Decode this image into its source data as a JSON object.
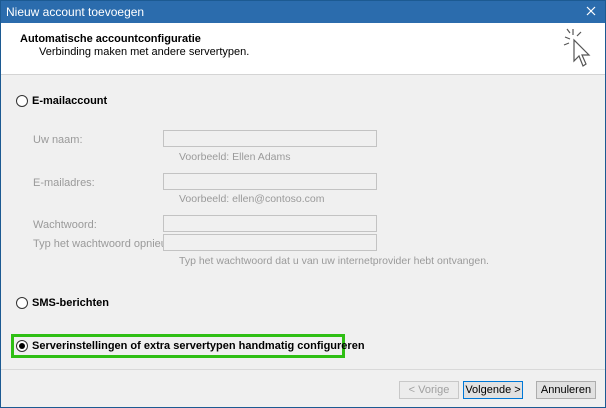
{
  "window": {
    "title": "Nieuw account toevoegen"
  },
  "header": {
    "title": "Automatische accountconfiguratie",
    "subtitle": "Verbinding maken met andere servertypen."
  },
  "options": {
    "email_account": "E-mailaccount",
    "sms": "SMS-berichten",
    "manual": "Serverinstellingen of extra servertypen handmatig configureren",
    "selected": "manual"
  },
  "fields": {
    "name_label": "Uw naam:",
    "name_hint": "Voorbeeld: Ellen Adams",
    "email_label": "E-mailadres:",
    "email_hint": "Voorbeeld: ellen@contoso.com",
    "password_label": "Wachtwoord:",
    "retype_label": "Typ het wachtwoord opnieuw:",
    "password_hint": "Typ het wachtwoord dat u van uw internetprovider hebt ontvangen."
  },
  "buttons": {
    "back": "< Vorige",
    "next": "Volgende >",
    "cancel": "Annuleren"
  },
  "colors": {
    "titlebar": "#2b6cad",
    "highlight": "#2fbf14"
  },
  "icons": {
    "close": "close-icon",
    "wizard": "cursor-sparkle-icon"
  }
}
